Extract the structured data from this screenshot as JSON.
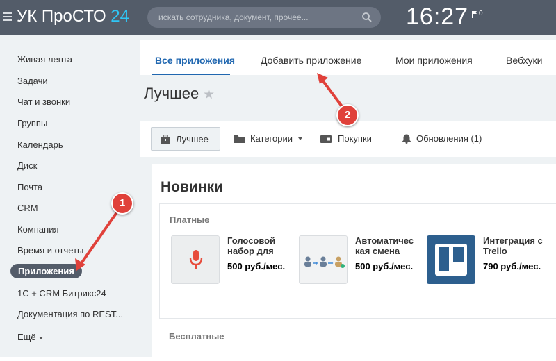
{
  "topbar": {
    "logo_text": "УК ПроСТО",
    "logo_number": "24",
    "search_placeholder": "искать сотрудника, документ, прочее...",
    "clock": "16:27",
    "flag_count": "0"
  },
  "sidebar": {
    "items": [
      {
        "label": "Живая лента"
      },
      {
        "label": "Задачи"
      },
      {
        "label": "Чат и звонки"
      },
      {
        "label": "Группы"
      },
      {
        "label": "Календарь"
      },
      {
        "label": "Диск"
      },
      {
        "label": "Почта"
      },
      {
        "label": "CRM"
      },
      {
        "label": "Компания"
      },
      {
        "label": "Время и отчеты"
      },
      {
        "label": "Приложения",
        "active": true
      },
      {
        "label": "1С + CRM Битрикс24"
      },
      {
        "label": "Документация по REST..."
      },
      {
        "label": "Ещё"
      }
    ]
  },
  "tabs": [
    {
      "label": "Все приложения",
      "active": true
    },
    {
      "label": "Добавить приложение"
    },
    {
      "label": "Мои приложения"
    },
    {
      "label": "Вебхуки"
    }
  ],
  "page_title": "Лучшее",
  "toolbar": {
    "best": "Лучшее",
    "categories": "Категории",
    "purchases": "Покупки",
    "updates": "Обновления (1)"
  },
  "section_title": "Новинки",
  "paid": {
    "title": "Платные",
    "apps": [
      {
        "name_line1": "Голосовой",
        "name_line2": "набор для",
        "price": "500 руб./мес.",
        "icon": "microphone-icon"
      },
      {
        "name_line1": "Автоматичес",
        "name_line2": "кая смена",
        "price": "500 руб./мес.",
        "icon": "user-swap-icon"
      },
      {
        "name_line1": "Интеграция с",
        "name_line2": "Trello",
        "price": "790 руб./мес.",
        "icon": "trello-icon"
      }
    ]
  },
  "free": {
    "title": "Бесплатные"
  },
  "callouts": {
    "one": "1",
    "two": "2"
  },
  "colors": {
    "topbar": "#535c69",
    "accent_blue": "#2067b0",
    "logo_number": "#2fc6f6",
    "callout_red": "#e0413a",
    "mic_red": "#e74c3c",
    "trello_blue": "#2d5f8e"
  }
}
